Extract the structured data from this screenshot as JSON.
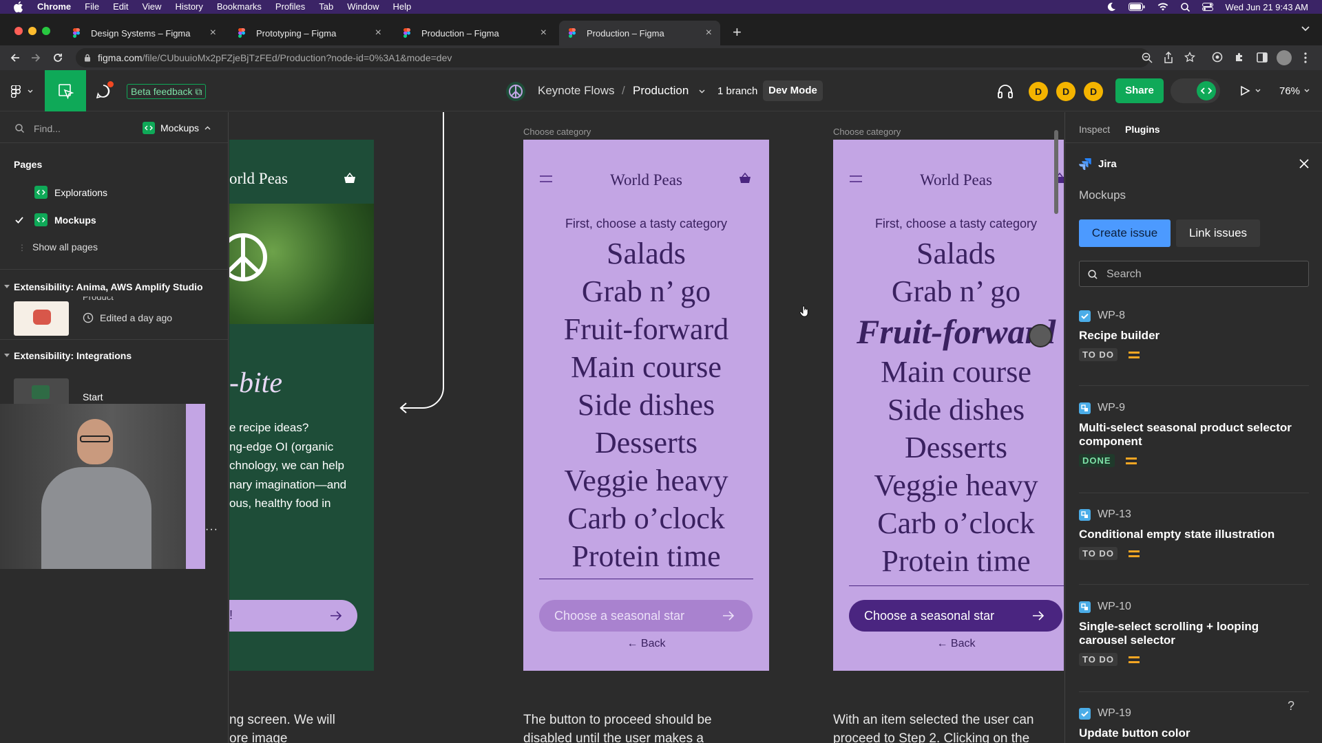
{
  "menubar": {
    "app": "Chrome",
    "items": [
      "File",
      "Edit",
      "View",
      "History",
      "Bookmarks",
      "Profiles",
      "Tab",
      "Window",
      "Help"
    ],
    "clock": "Wed Jun 21  9:43 AM"
  },
  "tabs": [
    {
      "label": "Design Systems – Figma"
    },
    {
      "label": "Prototyping – Figma"
    },
    {
      "label": "Production – Figma"
    },
    {
      "label": "Production – Figma"
    }
  ],
  "address": {
    "domain": "figma.com",
    "path": "/file/CUbuuioMx2pFZjeBjTzFEd/Production?node-id=0%3A1&mode=dev"
  },
  "toolbar": {
    "beta_feedback": "Beta feedback",
    "file_name": "Keynote Flows",
    "separator": "/",
    "page_name": "Production",
    "branch": "1 branch",
    "dev_mode": "Dev Mode",
    "avatars": [
      "D",
      "D",
      "D"
    ],
    "share": "Share",
    "zoom": "76%"
  },
  "left_panel": {
    "find_placeholder": "Find...",
    "page_selector": "Mockups",
    "pages_heading": "Pages",
    "pages": [
      {
        "label": "Explorations",
        "checked": false
      },
      {
        "label": "Mockups",
        "checked": true
      }
    ],
    "show_all": "Show all pages",
    "sections": [
      {
        "title": "Extensibility: Anima, AWS Amplify Studio",
        "item_title": "Product",
        "item_meta": "Edited a day ago"
      },
      {
        "title": "Extensibility: Integrations",
        "item_title": "Start"
      }
    ]
  },
  "canvas": {
    "left_frame": {
      "brand": "orld Peas",
      "headline": "-bite",
      "body": [
        "e recipe ideas?",
        "ng-edge OI (organic",
        "chnology, we can help",
        "nary imagination—and",
        "ous, healthy food in"
      ],
      "cta": "!"
    },
    "frame_label_1": "Choose category",
    "frame_label_2": "Choose category",
    "frame": {
      "brand": "World Peas",
      "subtitle": "First, choose a tasty category",
      "categories": [
        "Salads",
        "Grab n’ go",
        "Fruit-forward",
        "Main course",
        "Side dishes",
        "Desserts",
        "Veggie heavy",
        "Carb o’clock",
        "Protein time"
      ],
      "cta": "Choose a seasonal star",
      "back": "← Back"
    },
    "selected_category": "Fruit-forward",
    "descriptions": [
      {
        "lines": [
          "ng screen. We will",
          "ore image"
        ]
      },
      {
        "lines": [
          "The button to proceed should be",
          "disabled until the user makes a"
        ]
      },
      {
        "lines": [
          "With an item selected the user can",
          "proceed to Step 2. Clicking on the"
        ]
      }
    ]
  },
  "right_panel": {
    "tabs": [
      "Inspect",
      "Plugins"
    ],
    "plugin_name": "Jira",
    "context": "Mockups",
    "create_issue": "Create issue",
    "link_issues": "Link issues",
    "search_placeholder": "Search",
    "issues": [
      {
        "key": "WP-8",
        "title": "Recipe builder",
        "status": "TO DO"
      },
      {
        "key": "WP-9",
        "title": "Multi-select seasonal product selector component",
        "status": "DONE"
      },
      {
        "key": "WP-13",
        "title": "Conditional empty state illustration",
        "status": "TO DO"
      },
      {
        "key": "WP-10",
        "title": "Single-select scrolling + looping carousel selector",
        "status": "TO DO"
      },
      {
        "key": "WP-19",
        "title": "Update button color",
        "status": ""
      }
    ],
    "help": "?"
  },
  "colors": {
    "accent_green": "#0fa958",
    "frame_purple": "#c3a5e4",
    "deep_purple": "#4a2580",
    "forest_green": "#1e4d38",
    "jira_blue": "#4c9aff",
    "avatar_yellow": "#f4b400"
  }
}
